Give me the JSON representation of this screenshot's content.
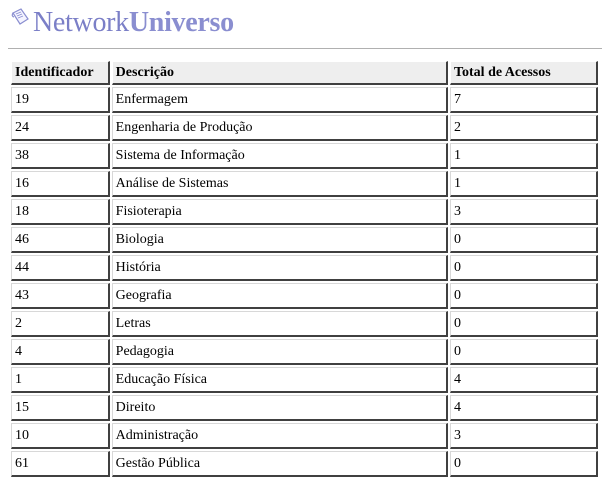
{
  "logo": {
    "text_light": "Network",
    "text_bold": "Universo",
    "icon": "document-scroll-icon"
  },
  "table": {
    "headers": [
      "Identificador",
      "Descrição",
      "Total de Acessos"
    ],
    "rows": [
      [
        "19",
        "Enfermagem",
        "7"
      ],
      [
        "24",
        "Engenharia de Produção",
        "2"
      ],
      [
        "38",
        "Sistema de Informação",
        "1"
      ],
      [
        "16",
        "Análise de Sistemas",
        "1"
      ],
      [
        "18",
        "Fisioterapia",
        "3"
      ],
      [
        "46",
        "Biologia",
        "0"
      ],
      [
        "44",
        "História",
        "0"
      ],
      [
        "43",
        "Geografia",
        "0"
      ],
      [
        "2",
        "Letras",
        "0"
      ],
      [
        "4",
        "Pedagogia",
        "0"
      ],
      [
        "1",
        "Educação Física",
        "4"
      ],
      [
        "15",
        "Direito",
        "4"
      ],
      [
        "10",
        "Administração",
        "3"
      ],
      [
        "61",
        "Gestão Pública",
        "0"
      ]
    ]
  },
  "colors": {
    "brand": "#7b7fc7",
    "header_bg": "#eeeeee"
  }
}
